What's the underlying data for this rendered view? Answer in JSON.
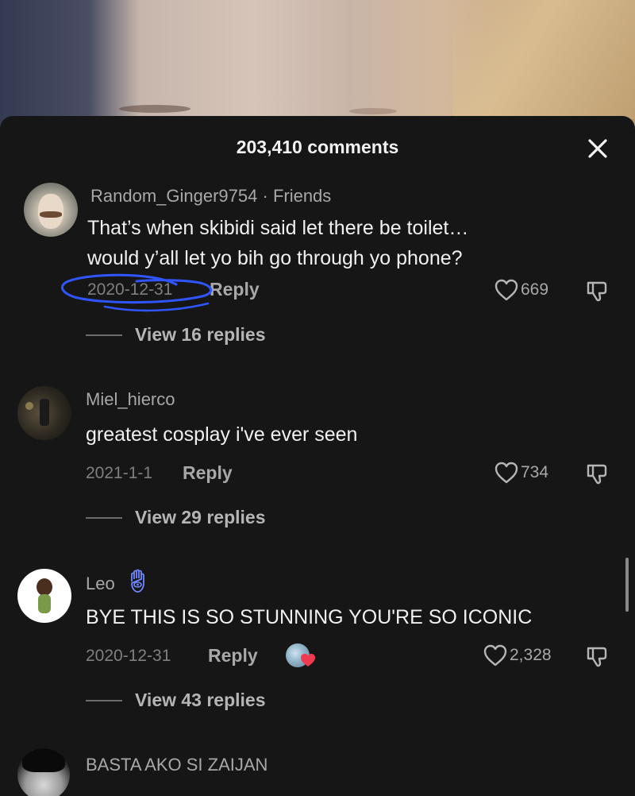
{
  "header": {
    "comment_count": "203,410 comments"
  },
  "comments": [
    {
      "username": "Random_Ginger9754",
      "relation": "Friends",
      "text_lines": [
        "That’s when skibidi said let there be toilet…",
        "would y’all let yo bih go through yo phone?"
      ],
      "date": "2020-12-31",
      "reply_label": "Reply",
      "likes": "669",
      "view_replies": "View 16 replies"
    },
    {
      "username": "Miel_hierco",
      "text_lines": [
        "greatest cosplay i've ever seen"
      ],
      "date": "2021-1-1",
      "reply_label": "Reply",
      "likes": "734",
      "view_replies": "View 29 replies"
    },
    {
      "username": "Leo",
      "badge_icon": "hamsa-icon",
      "text_lines": [
        "BYE THIS IS SO STUNNING YOU'RE SO ICONIC"
      ],
      "date": "2020-12-31",
      "reply_label": "Reply",
      "creator_liked": true,
      "likes": "2,328",
      "view_replies": "View 43 replies"
    },
    {
      "username": "BASTA AKO SI ZAIJAN"
    }
  ],
  "icons": {
    "close": "close-icon",
    "like": "heart-outline-icon",
    "dislike": "thumbs-down-icon"
  },
  "colors": {
    "sheet_bg": "#161616",
    "annotation": "#2f55ff",
    "like_heart": "#f03a4f"
  }
}
